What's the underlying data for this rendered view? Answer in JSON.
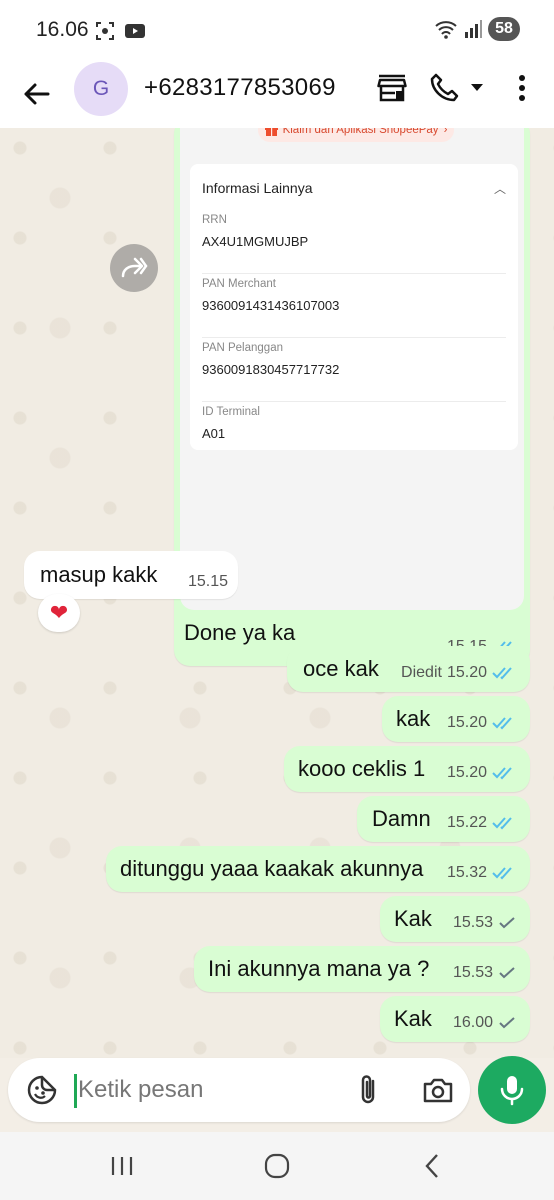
{
  "status_bar": {
    "time": "16.06",
    "battery": "58"
  },
  "header": {
    "avatar_letter": "G",
    "contact_name": "+6283177853069"
  },
  "screenshot": {
    "claim_text": "Klaim dari Aplikasi ShopeePay",
    "section_title": "Informasi Lainnya",
    "fields": [
      {
        "label": "RRN",
        "value": "AX4U1MGMUJBP"
      },
      {
        "label": "PAN Merchant",
        "value": "9360091431436107003"
      },
      {
        "label": "PAN Pelanggan",
        "value": "9360091830457717732"
      },
      {
        "label": "ID Terminal",
        "value": "A01"
      }
    ]
  },
  "messages": [
    {
      "direction": "out",
      "text": "Done ya ka",
      "time": "15.15",
      "status": "read",
      "edited": ""
    },
    {
      "direction": "in",
      "text": "masup kakk",
      "time": "15.15",
      "reaction": "❤"
    },
    {
      "direction": "out",
      "text": "oce kak",
      "time": "15.20",
      "status": "read",
      "edited": "Diedit"
    },
    {
      "direction": "out",
      "text": "kak",
      "time": "15.20",
      "status": "read",
      "edited": ""
    },
    {
      "direction": "out",
      "text": "kooo ceklis 1",
      "time": "15.20",
      "status": "read",
      "edited": ""
    },
    {
      "direction": "out",
      "text": "Damn",
      "time": "15.22",
      "status": "read",
      "edited": ""
    },
    {
      "direction": "out",
      "text": "ditunggu yaaa kaakak akunnya",
      "time": "15.32",
      "status": "read",
      "edited": ""
    },
    {
      "direction": "out",
      "text": "Kak",
      "time": "15.53",
      "status": "sent",
      "edited": ""
    },
    {
      "direction": "out",
      "text": "Ini akunnya mana ya ?",
      "time": "15.53",
      "status": "sent",
      "edited": ""
    },
    {
      "direction": "out",
      "text": "Kak",
      "time": "16.00",
      "status": "sent",
      "edited": ""
    }
  ],
  "composer": {
    "placeholder": "Ketik pesan"
  },
  "icons": {
    "back": "arrow-left-icon",
    "store": "storefront-icon",
    "call": "phone-icon",
    "menu": "more-vert-icon",
    "forward": "forward-icon",
    "sticker": "sticker-icon",
    "attach": "paperclip-icon",
    "camera": "camera-icon",
    "mic": "microphone-icon"
  },
  "colors": {
    "outgoing_bubble": "#d9fdd3",
    "incoming_bubble": "#ffffff",
    "accent_green": "#1daa61",
    "read_tick": "#53bdeb",
    "sent_tick": "#667781",
    "shopee_orange": "#ee4d2d"
  }
}
